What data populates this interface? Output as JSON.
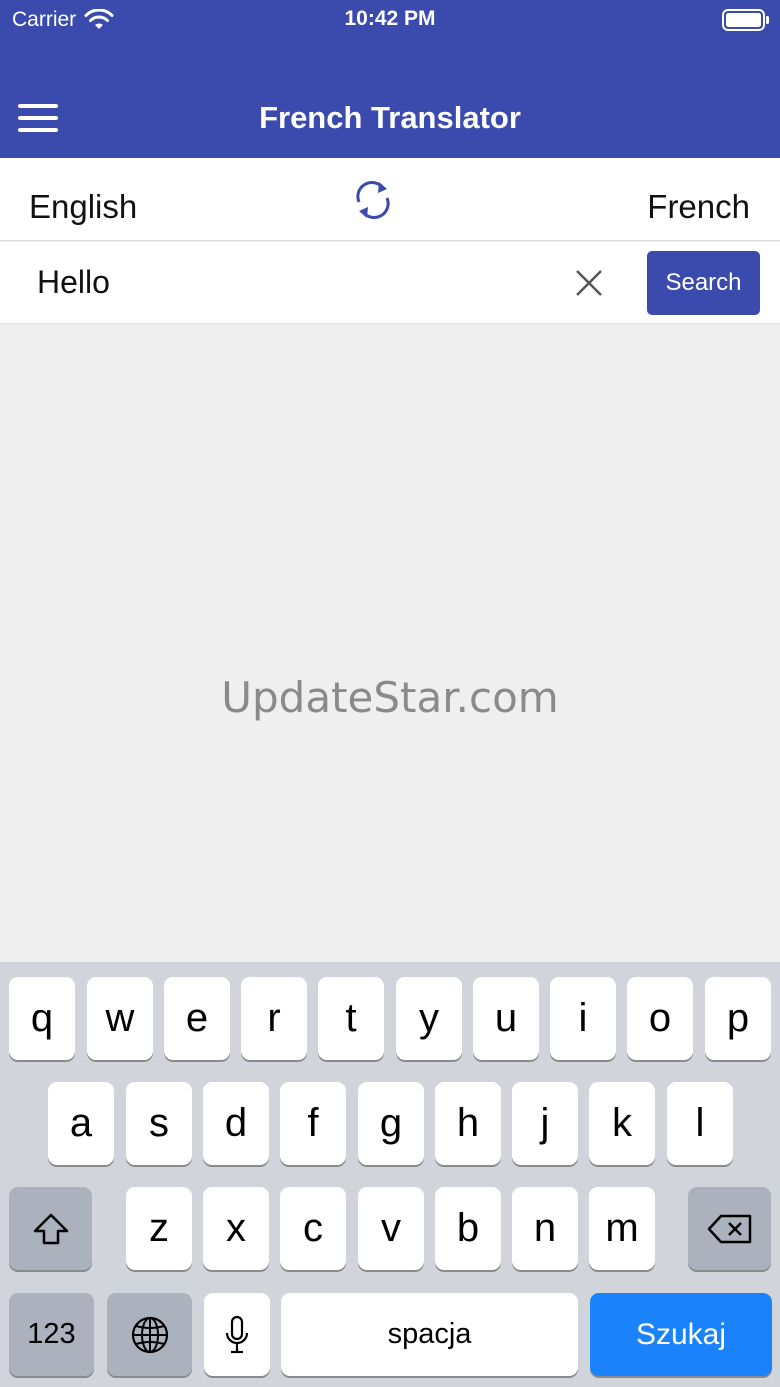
{
  "status_bar": {
    "carrier": "Carrier",
    "time": "10:42 PM"
  },
  "header": {
    "title": "French Translator",
    "menu_icon": "hamburger-menu-icon"
  },
  "languages": {
    "source": "English",
    "target": "French",
    "swap_icon": "swap-refresh-icon"
  },
  "search": {
    "value": "Hello",
    "button_label": "Search",
    "clear_icon": "close-x-icon"
  },
  "watermark": "UpdateStar.com",
  "keyboard": {
    "row1": [
      "q",
      "w",
      "e",
      "r",
      "t",
      "y",
      "u",
      "i",
      "o",
      "p"
    ],
    "row2": [
      "a",
      "s",
      "d",
      "f",
      "g",
      "h",
      "j",
      "k",
      "l"
    ],
    "row3": [
      "z",
      "x",
      "c",
      "v",
      "b",
      "n",
      "m"
    ],
    "numbers_label": "123",
    "space_label": "spacja",
    "return_label": "Szukaj",
    "icons": [
      "shift-icon",
      "backspace-icon",
      "globe-icon",
      "microphone-icon"
    ]
  },
  "colors": {
    "primary": "#3a4aad",
    "keyboard_bg": "#d1d4db",
    "return_key": "#1a82fb"
  }
}
